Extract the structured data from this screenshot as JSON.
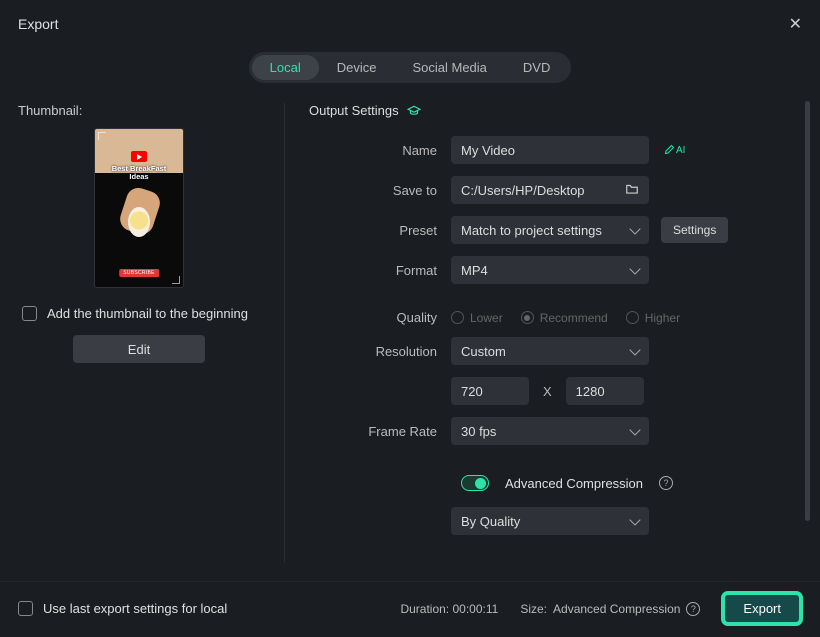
{
  "header": {
    "title": "Export"
  },
  "tabs": [
    "Local",
    "Device",
    "Social Media",
    "DVD"
  ],
  "thumbnail": {
    "label": "Thumbnail:",
    "visible_text_top": "Best BreakFast",
    "visible_text_bottom": "Ideas",
    "subscribe_text": "SUBSCRIBE",
    "add_label": "Add the thumbnail to the beginning",
    "edit_label": "Edit"
  },
  "output": {
    "section_title": "Output Settings",
    "name_label": "Name",
    "name_value": "My Video",
    "ai_label": "AI",
    "saveto_label": "Save to",
    "saveto_value": "C:/Users/HP/Desktop",
    "preset_label": "Preset",
    "preset_value": "Match to project settings",
    "settings_btn": "Settings",
    "format_label": "Format",
    "format_value": "MP4",
    "quality_label": "Quality",
    "quality_options": [
      "Lower",
      "Recommend",
      "Higher"
    ],
    "quality_selected": "Recommend",
    "resolution_label": "Resolution",
    "resolution_value": "Custom",
    "res_w": "720",
    "res_h": "1280",
    "framerate_label": "Frame Rate",
    "framerate_value": "30 fps",
    "advcomp_label": "Advanced Compression",
    "compression_mode": "By Quality"
  },
  "footer": {
    "uselast_label": "Use last export settings for local",
    "duration_label": "Duration:",
    "duration_value": "00:00:11",
    "size_label": "Size:",
    "size_value": "Advanced Compression",
    "export_btn": "Export"
  }
}
